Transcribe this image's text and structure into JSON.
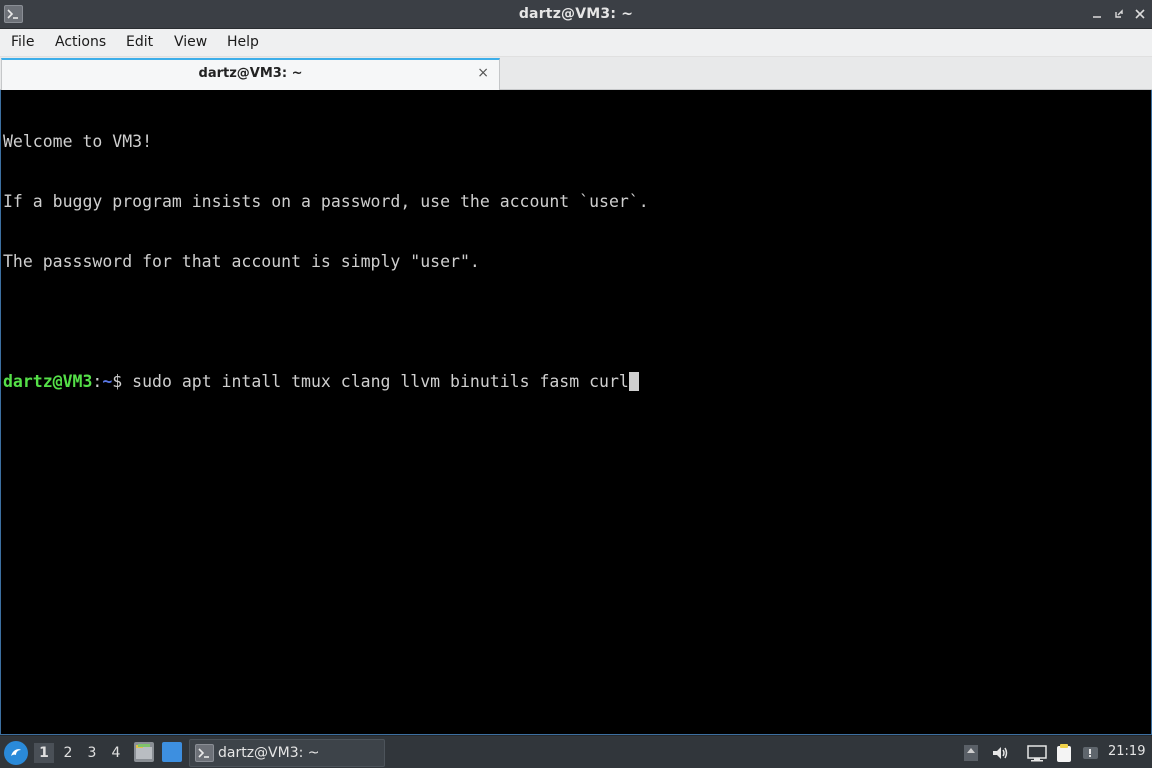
{
  "window": {
    "title": "dartz@VM3: ~",
    "controls": [
      "minimize-icon",
      "restore-icon",
      "close-icon"
    ]
  },
  "menubar": {
    "items": [
      {
        "label": "File"
      },
      {
        "label": "Actions"
      },
      {
        "label": "Edit"
      },
      {
        "label": "View"
      },
      {
        "label": "Help"
      }
    ]
  },
  "tabs": [
    {
      "label": "dartz@VM3: ~",
      "close_glyph": "×",
      "active": true
    }
  ],
  "terminal": {
    "lines": [
      "Welcome to VM3!",
      "If a buggy program insists on a password, use the account `user`.",
      "The passsword for that account is simply \"user\".",
      ""
    ],
    "prompt": {
      "user_host": "dartz@VM3",
      "separator": ":",
      "path": "~",
      "symbol": "$ ",
      "command": "sudo apt intall tmux clang llvm binutils fasm curl"
    },
    "colors": {
      "background": "#000000",
      "text": "#cfcfcf",
      "user_host": "#55e048",
      "path": "#5b79e8"
    }
  },
  "taskbar": {
    "desktops": [
      "1",
      "2",
      "3",
      "4"
    ],
    "active_desktop": "1",
    "task": {
      "label": "dartz@VM3: ~"
    },
    "tray_icons": [
      "tray-expand-icon",
      "volume-icon",
      "network-icon",
      "clipboard-icon",
      "notification-icon"
    ],
    "clock": "21:19"
  },
  "colors": {
    "accent": "#3daee9",
    "titlebar": "#3b3f45",
    "taskbar": "#31363b"
  }
}
